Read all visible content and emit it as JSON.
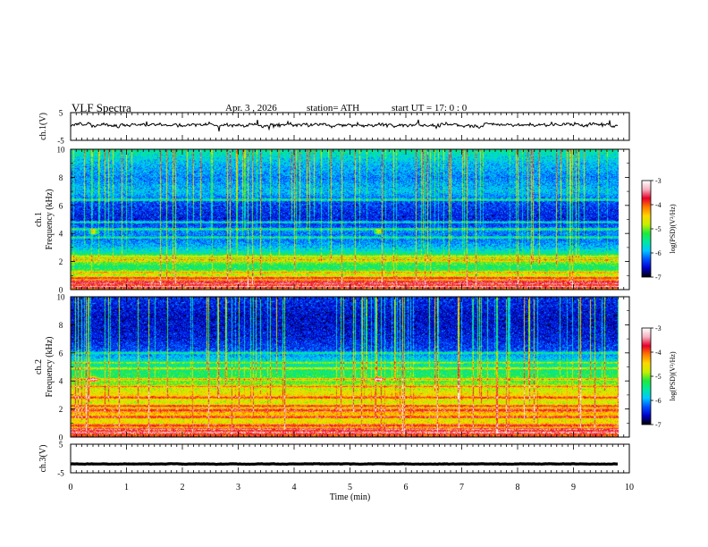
{
  "header": {
    "title": "VLF Spectra",
    "date": "Apr. 3 , 2026",
    "station": "station= ATH",
    "start": "start UT =  17: 0 : 0"
  },
  "chart_data": [
    {
      "type": "line",
      "panel": "ch1-waveform",
      "ylabel": "ch.1(V)",
      "ylim": [
        -5,
        5
      ],
      "yticks": [
        "5",
        "-5"
      ],
      "xlim": [
        0,
        10
      ],
      "trace_level_v": 0.6,
      "trace_noise_v": 1.2
    },
    {
      "type": "heatmap",
      "panel": "ch1-spectrogram",
      "ylabel_top": "ch.1",
      "ylabel": "Frequency (kHz)",
      "ylim": [
        0,
        10
      ],
      "yticks": [
        "0",
        "2",
        "4",
        "6",
        "8",
        "10"
      ],
      "x_end_min": 9.8,
      "colorbar": {
        "label": "log(PSD)(V²/Hz)",
        "range": [
          -7,
          -3
        ],
        "ticks": [
          "-3",
          "-4",
          "-5",
          "-6",
          "-7"
        ],
        "colors": [
          "#000000",
          "#0000cc",
          "#0050ff",
          "#00c8ff",
          "#00e8a0",
          "#22e83c",
          "#c8f000",
          "#ffd700",
          "#ff7a00",
          "#e8002a",
          "#f5b0c0",
          "#ffffff"
        ]
      },
      "profile": [
        [
          0,
          -4.0
        ],
        [
          0.4,
          -4.3
        ],
        [
          0.8,
          -4.5
        ],
        [
          1.2,
          -5.0
        ],
        [
          1.6,
          -5.4
        ],
        [
          2.0,
          -4.9
        ],
        [
          2.4,
          -5.3
        ],
        [
          3.0,
          -5.9
        ],
        [
          3.6,
          -6.2
        ],
        [
          4.2,
          -6.1
        ],
        [
          5.0,
          -6.5
        ],
        [
          6.2,
          -6.3
        ],
        [
          7.0,
          -5.9
        ],
        [
          8.0,
          -6.1
        ],
        [
          9.0,
          -5.9
        ],
        [
          10.0,
          -5.5
        ]
      ],
      "lines_khz": [
        0.2,
        0.4,
        0.55,
        0.8,
        1.2,
        2.1,
        2.35,
        3.7,
        4.3,
        4.8,
        6.4
      ],
      "event_markers": [
        {
          "t_min": 0.4,
          "f_khz": 4.1
        },
        {
          "t_min": 5.5,
          "f_khz": 4.1
        }
      ]
    },
    {
      "type": "heatmap",
      "panel": "ch2-spectrogram",
      "ylabel_top": "ch.2",
      "ylabel": "Frequency (kHz)",
      "ylim": [
        0,
        10
      ],
      "yticks": [
        "0",
        "2",
        "4",
        "6",
        "8",
        "10"
      ],
      "x_end_min": 9.8,
      "colorbar": {
        "label": "log(PSD)(V²/Hz)",
        "range": [
          -7,
          -3
        ],
        "ticks": [
          "-3",
          "-4",
          "-5",
          "-6",
          "-7"
        ],
        "colors": [
          "#000000",
          "#0000cc",
          "#0050ff",
          "#00c8ff",
          "#00e8a0",
          "#22e83c",
          "#c8f000",
          "#ffd700",
          "#ff7a00",
          "#e8002a",
          "#f5b0c0",
          "#ffffff"
        ]
      },
      "profile": [
        [
          0,
          -3.9
        ],
        [
          0.6,
          -4.3
        ],
        [
          1.2,
          -4.6
        ],
        [
          1.8,
          -4.3
        ],
        [
          2.4,
          -4.7
        ],
        [
          3.0,
          -4.5
        ],
        [
          3.6,
          -4.9
        ],
        [
          4.2,
          -5.2
        ],
        [
          4.8,
          -5.4
        ],
        [
          5.4,
          -5.7
        ],
        [
          6.2,
          -6.3
        ],
        [
          7.0,
          -6.5
        ],
        [
          8.5,
          -6.6
        ],
        [
          10.0,
          -6.4
        ]
      ],
      "lines_khz": [
        0.3,
        0.5,
        0.8,
        1.4,
        1.9,
        2.2,
        2.8,
        3.6,
        4.1,
        4.9,
        5.3,
        6.0
      ],
      "event_markers": [
        {
          "t_min": 0.4,
          "f_khz": 4.1
        },
        {
          "t_min": 5.5,
          "f_khz": 4.1
        }
      ]
    },
    {
      "type": "line",
      "panel": "ch3-waveform",
      "ylabel": "ch.3(V)",
      "ylim": [
        -5,
        5
      ],
      "yticks": [
        "5",
        "-5"
      ],
      "xlim": [
        0,
        10
      ],
      "trace_level_v": -1.9,
      "trace_noise_v": 0.15,
      "xlabel": "Time (min)",
      "xticks": [
        "0",
        "1",
        "2",
        "3",
        "4",
        "5",
        "6",
        "7",
        "8",
        "9",
        "10"
      ]
    }
  ]
}
